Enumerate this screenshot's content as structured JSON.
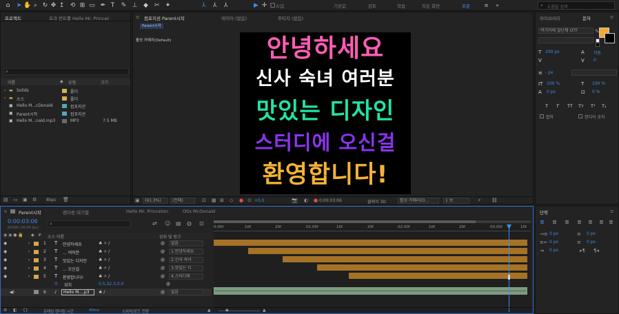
{
  "toolbar": {
    "workspaces": [
      "기본값",
      "검토",
      "학습",
      "작은 화면",
      "표준"
    ],
    "active_workspace": "표준",
    "search_placeholder": "도움말 검색",
    "snap_label": "스냅",
    "icons": [
      "home-icon",
      "selection-icon",
      "hand-icon",
      "zoom-icon",
      "orbit-icon",
      "move-icon",
      "rotate-icon",
      "camera-icon",
      "pan-behind-icon",
      "rect-mask-icon",
      "pen-icon",
      "type-icon",
      "brush-icon",
      "clone-icon",
      "eraser-icon",
      "roto-icon",
      "puppet-icon"
    ]
  },
  "project_panel": {
    "tabs": [
      "프로젝트",
      "효과 컨트롤 Hello Mr. Princet"
    ],
    "search_placeholder": "",
    "columns": [
      "이름",
      "유형",
      "크기"
    ],
    "items": [
      {
        "name": "Solids",
        "type": "폴더",
        "size": "",
        "color": "#d4b15a"
      },
      {
        "name": "소스",
        "type": "폴더",
        "size": "",
        "color": "#d4b15a"
      },
      {
        "name": "Hello M...cDonald",
        "type": "컴포지션",
        "size": "",
        "color": "#53a8b5"
      },
      {
        "name": "Parent시작",
        "type": "컴포지션",
        "size": "",
        "color": "#53a8b5"
      },
      {
        "name": "Hello M...nald.mp3",
        "type": "MP3",
        "size": "7.5 MB",
        "color": "#6b6b6b"
      }
    ],
    "footer_bpc": "8bpc"
  },
  "comp_panel": {
    "tabs": [
      "컴포지션 Parent시작",
      "레이어 (없음)",
      "푸티지 (없음)"
    ],
    "breadcrumb": "Parent시작",
    "camera_label": "활성 카메라(Default)",
    "lines": [
      {
        "text": "안녕하세요",
        "color": "#ff5db5"
      },
      {
        "text": "신사 숙녀 여러분",
        "color": "#ffffff"
      },
      {
        "text": "맛있는 디자인",
        "color": "#21e4a6"
      },
      {
        "text": "스터디에 오신걸",
        "color": "#8b34f0"
      },
      {
        "text": "환영합니다!",
        "color": "#f5b236"
      }
    ],
    "footer": {
      "zoom": "(61.3%)",
      "resolution": "(전체)",
      "exposure": "+0.0",
      "timecode": "0:00:03:06",
      "renderer": "클래식 3D",
      "camera": "활성 카메라(D...",
      "views": "1 보"
    }
  },
  "char_panel": {
    "tabs": [
      "라이브러리",
      "문자"
    ],
    "font": "여기어때 잘난체 OTF",
    "font_style": "",
    "size": "200 px",
    "leading": "자동",
    "kerning": "",
    "tracking": "0",
    "stroke": "- px",
    "vscale": "100 %",
    "hscale": "100 %",
    "baseline": "0 px",
    "tsume": "0 %",
    "style_buttons": [
      "T",
      "T",
      "TT",
      "Tт",
      "T¹",
      "T₁"
    ],
    "ligature_label": "합자",
    "hindi_label": "힌디어 숫자",
    "fill_color": "#f5a936"
  },
  "align_panel": {
    "title": "단락",
    "values": [
      "0 px",
      "0 px",
      "0 px",
      "0 px",
      "0 px"
    ]
  },
  "timeline": {
    "tabs": [
      "Parent시작",
      "렌더링 대기열",
      "Hello Mr. Princeton",
      "Otis McDonald"
    ],
    "timecode": "0:00:03:06",
    "timecode_sub": "00096 (30.00 fps)",
    "columns": [
      "소스 이름",
      "상위 및 링크"
    ],
    "ruler": [
      "0:00f",
      "10f",
      "20f",
      "01:00f",
      "10f",
      "20f",
      "02:00f",
      "10f",
      "20f",
      "03:00f",
      "10f"
    ],
    "layers": [
      {
        "num": "1",
        "type": "T",
        "name": "안녕하세요",
        "parent": "없음",
        "label": "#d4a54a",
        "bar_start": 0.0
      },
      {
        "num": "2",
        "type": "T",
        "name": "... 여러분",
        "parent": "1.안녕하세요",
        "label": "#d4a54a",
        "bar_start": 0.11
      },
      {
        "num": "3",
        "type": "T",
        "name": "맛있는 디자인",
        "parent": "2.신사 숙녀",
        "label": "#d4a54a",
        "bar_start": 0.22
      },
      {
        "num": "4",
        "type": "T",
        "name": "... 오신걸",
        "parent": "3.맛있는 디",
        "label": "#d4a54a",
        "bar_start": 0.33
      },
      {
        "num": "5",
        "type": "T",
        "name": "환영합니다!",
        "parent": "4.스터디에",
        "label": "#d4a54a",
        "bar_start": 0.43
      }
    ],
    "position_row": {
      "label": "위치",
      "value": "0.5,32.3,0.0"
    },
    "audio_layer": {
      "num": "6",
      "name": "Hello M....p3",
      "parent": "없음"
    },
    "footer": {
      "render_time_label": "프레임 렌더링 시간",
      "render_time": "40ms",
      "toggle_label": "스위치/모드 전환"
    }
  }
}
